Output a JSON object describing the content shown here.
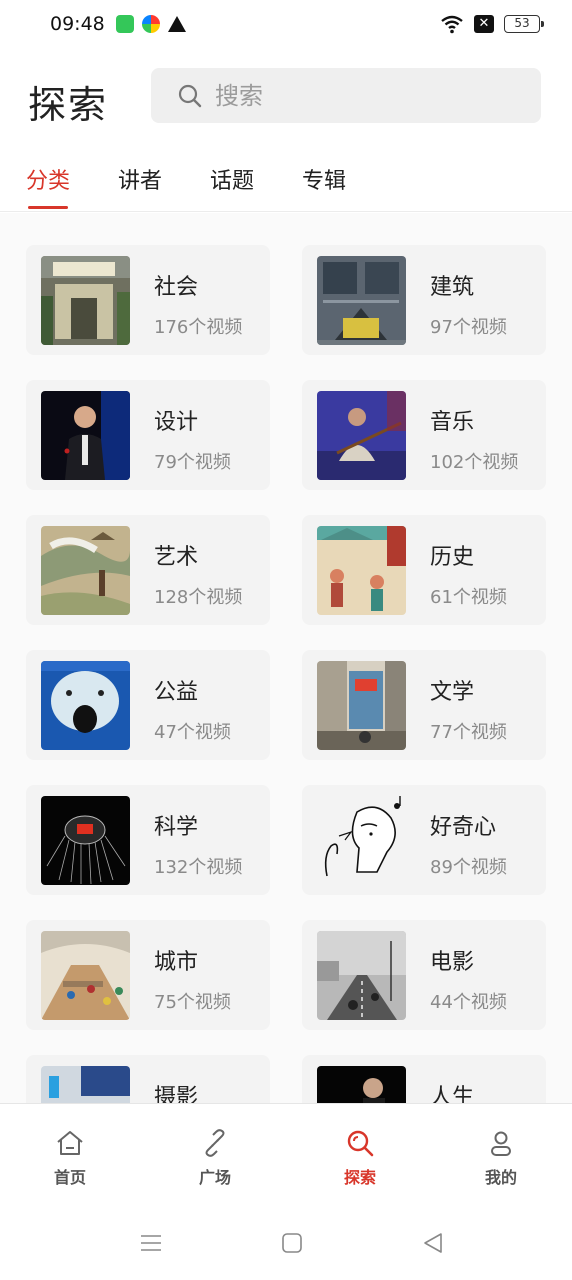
{
  "status_bar": {
    "time": "09:48",
    "battery": "53",
    "icons": [
      "app-green-icon",
      "app-colorful-icon",
      "warning-icon",
      "wifi-icon",
      "x-box-icon",
      "battery-icon"
    ]
  },
  "header": {
    "title": "探索",
    "search_placeholder": "搜索"
  },
  "tabs": [
    {
      "label": "分类",
      "active": true
    },
    {
      "label": "讲者",
      "active": false
    },
    {
      "label": "话题",
      "active": false
    },
    {
      "label": "专辑",
      "active": false
    }
  ],
  "categories": [
    {
      "title": "社会",
      "count": "176个视频"
    },
    {
      "title": "建筑",
      "count": "97个视频"
    },
    {
      "title": "设计",
      "count": "79个视频"
    },
    {
      "title": "音乐",
      "count": "102个视频"
    },
    {
      "title": "艺术",
      "count": "128个视频"
    },
    {
      "title": "历史",
      "count": "61个视频"
    },
    {
      "title": "公益",
      "count": "47个视频"
    },
    {
      "title": "文学",
      "count": "77个视频"
    },
    {
      "title": "科学",
      "count": "132个视频"
    },
    {
      "title": "好奇心",
      "count": "89个视频"
    },
    {
      "title": "城市",
      "count": "75个视频"
    },
    {
      "title": "电影",
      "count": "44个视频"
    },
    {
      "title": "摄影",
      "count": ""
    },
    {
      "title": "人生",
      "count": ""
    }
  ],
  "bottom_nav": [
    {
      "label": "首页",
      "icon": "home-icon",
      "active": false
    },
    {
      "label": "广场",
      "icon": "link-icon",
      "active": false
    },
    {
      "label": "探索",
      "icon": "search-icon",
      "active": true
    },
    {
      "label": "我的",
      "icon": "user-icon",
      "active": false
    }
  ],
  "system_nav": [
    "menu-icon",
    "home-square-icon",
    "back-triangle-icon"
  ],
  "colors": {
    "accent": "#d8362a",
    "card_bg": "#f3f3f3",
    "search_bg": "#efefef"
  }
}
